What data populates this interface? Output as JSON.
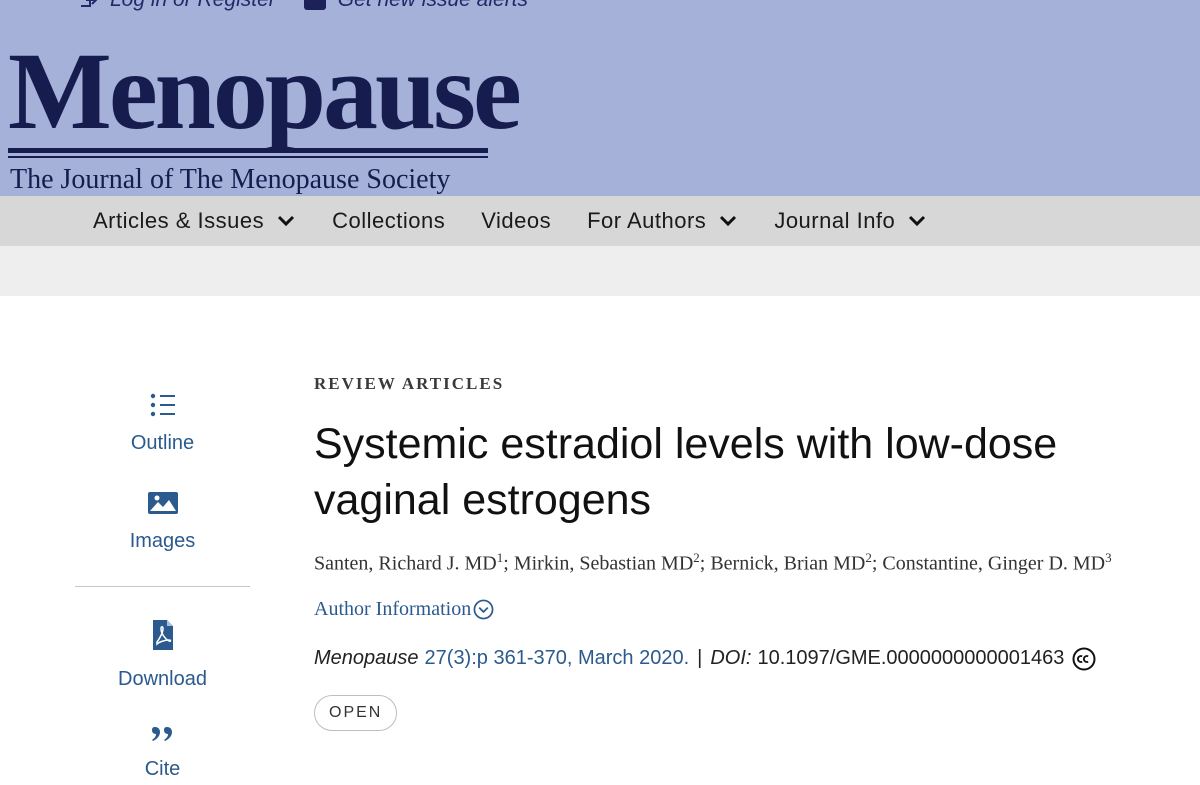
{
  "header": {
    "top_links": {
      "login": "Log in or Register",
      "alerts": "Get new issue alerts"
    },
    "logo_title": "Menopause",
    "logo_subtitle": "The Journal of The Menopause Society"
  },
  "nav": {
    "items": [
      {
        "label": "Articles & Issues",
        "dropdown": true
      },
      {
        "label": "Collections",
        "dropdown": false
      },
      {
        "label": "Videos",
        "dropdown": false
      },
      {
        "label": "For Authors",
        "dropdown": true
      },
      {
        "label": "Journal Info",
        "dropdown": true
      }
    ]
  },
  "sidebar": {
    "items": [
      {
        "label": "Outline",
        "icon": "outline-list-icon"
      },
      {
        "label": "Images",
        "icon": "image-icon"
      },
      {
        "label": "Download",
        "icon": "pdf-icon"
      },
      {
        "label": "Cite",
        "icon": "quote-icon"
      }
    ]
  },
  "article": {
    "section": "REVIEW ARTICLES",
    "title": "Systemic estradiol levels with low-dose vaginal estrogens",
    "authors": [
      {
        "name": "Santen, Richard J. MD",
        "sup": "1"
      },
      {
        "name": "Mirkin, Sebastian MD",
        "sup": "2"
      },
      {
        "name": "Bernick, Brian MD",
        "sup": "2"
      },
      {
        "name": "Constantine, Ginger D. MD",
        "sup": "3"
      }
    ],
    "author_info_label": "Author Information",
    "journal": "Menopause",
    "volume_info": "27(3):p 361-370, March 2020.",
    "separator": "|",
    "doi_label": "DOI:",
    "doi": "10.1097/GME.0000000000001463",
    "access_badge": "OPEN"
  },
  "colors": {
    "banner_bg": "#a6b1d9",
    "logo": "#161d4e",
    "nav_bg": "#d7d7d7",
    "link": "#2b5a8e"
  }
}
